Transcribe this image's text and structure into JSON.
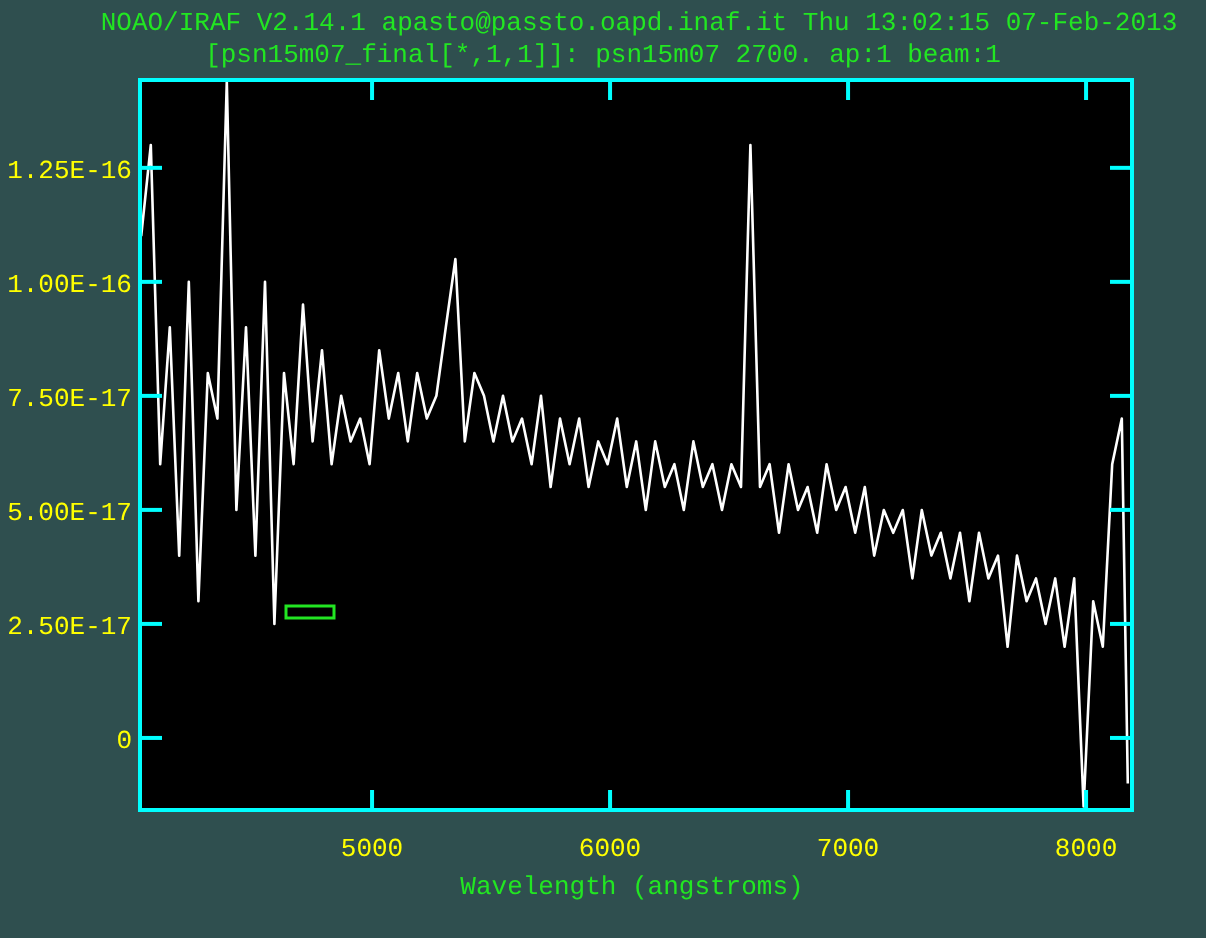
{
  "header": {
    "title": "NOAO/IRAF V2.14.1 apasto@passto.oapd.inaf.it Thu 13:02:15 07-Feb-2013",
    "subtitle": "[psn15m07_final[*,1,1]]: psn15m07 2700. ap:1 beam:1"
  },
  "plot": {
    "chart_data": {
      "type": "line",
      "xlabel": "Wavelength (angstroms)",
      "xlim": [
        4025,
        8193
      ],
      "ylim": [
        -1.58e-17,
        1.447e-16
      ],
      "xticks": [
        5000,
        6000,
        7000,
        8000
      ],
      "yticks": [
        {
          "value": 0,
          "label": "0"
        },
        {
          "value": 2.5e-17,
          "label": "2.50E-17"
        },
        {
          "value": 5e-17,
          "label": "5.00E-17"
        },
        {
          "value": 7.5e-17,
          "label": "7.50E-17"
        },
        {
          "value": 1e-16,
          "label": "1.00E-16"
        },
        {
          "value": 1.25e-16,
          "label": "1.25E-16"
        }
      ],
      "x": [
        4030,
        4070,
        4110,
        4150,
        4190,
        4230,
        4270,
        4310,
        4350,
        4390,
        4430,
        4470,
        4510,
        4550,
        4590,
        4630,
        4670,
        4710,
        4750,
        4790,
        4830,
        4870,
        4910,
        4950,
        4990,
        5030,
        5070,
        5110,
        5150,
        5190,
        5230,
        5270,
        5310,
        5350,
        5390,
        5430,
        5470,
        5510,
        5550,
        5590,
        5630,
        5670,
        5710,
        5750,
        5790,
        5830,
        5870,
        5910,
        5950,
        5990,
        6030,
        6070,
        6110,
        6150,
        6190,
        6230,
        6270,
        6310,
        6350,
        6390,
        6430,
        6470,
        6510,
        6550,
        6590,
        6630,
        6670,
        6710,
        6750,
        6790,
        6830,
        6870,
        6910,
        6950,
        6990,
        7030,
        7070,
        7110,
        7150,
        7190,
        7230,
        7270,
        7310,
        7350,
        7390,
        7430,
        7470,
        7510,
        7550,
        7590,
        7630,
        7670,
        7710,
        7750,
        7790,
        7830,
        7870,
        7910,
        7950,
        7990,
        8030,
        8070,
        8110,
        8150,
        8175
      ],
      "series": [
        {
          "color": "#ffffff",
          "values": [
            1.1e-16,
            1.3e-16,
            6e-17,
            9e-17,
            4e-17,
            1e-16,
            3e-17,
            8e-17,
            7e-17,
            1.44e-16,
            5e-17,
            9e-17,
            4e-17,
            1e-16,
            2.5e-17,
            8e-17,
            6e-17,
            9.5e-17,
            6.5e-17,
            8.5e-17,
            6e-17,
            7.5e-17,
            6.5e-17,
            7e-17,
            6e-17,
            8.5e-17,
            7e-17,
            8e-17,
            6.5e-17,
            8e-17,
            7e-17,
            7.5e-17,
            9e-17,
            1.05e-16,
            6.5e-17,
            8e-17,
            7.5e-17,
            6.5e-17,
            7.5e-17,
            6.5e-17,
            7e-17,
            6e-17,
            7.5e-17,
            5.5e-17,
            7e-17,
            6e-17,
            7e-17,
            5.5e-17,
            6.5e-17,
            6e-17,
            7e-17,
            5.5e-17,
            6.5e-17,
            5e-17,
            6.5e-17,
            5.5e-17,
            6e-17,
            5e-17,
            6.5e-17,
            5.5e-17,
            6e-17,
            5e-17,
            6e-17,
            5.5e-17,
            1.3e-16,
            5.5e-17,
            6e-17,
            4.5e-17,
            6e-17,
            5e-17,
            5.5e-17,
            4.5e-17,
            6e-17,
            5e-17,
            5.5e-17,
            4.5e-17,
            5.5e-17,
            4e-17,
            5e-17,
            4.5e-17,
            5e-17,
            3.5e-17,
            5e-17,
            4e-17,
            4.5e-17,
            3.5e-17,
            4.5e-17,
            3e-17,
            4.5e-17,
            3.5e-17,
            4e-17,
            2e-17,
            4e-17,
            3e-17,
            3.5e-17,
            2.5e-17,
            3.5e-17,
            2e-17,
            3.5e-17,
            -1.5e-17,
            3e-17,
            2e-17,
            6e-17,
            7e-17,
            -1e-17
          ]
        }
      ]
    }
  }
}
